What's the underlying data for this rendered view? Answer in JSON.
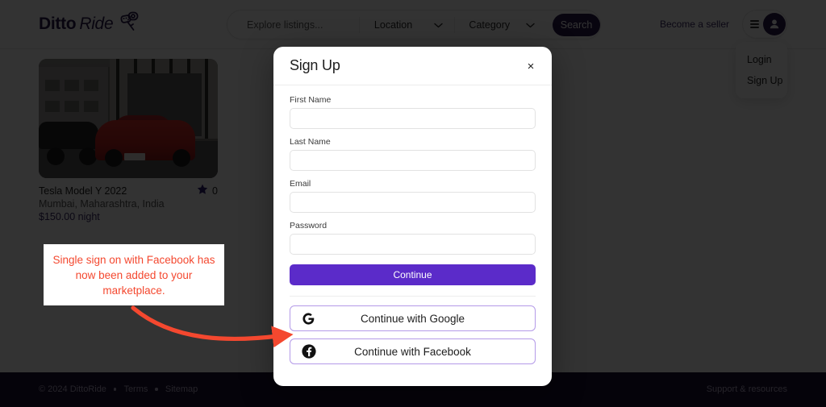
{
  "header": {
    "logo": {
      "part1": "Ditto",
      "part2": "Ride",
      "icon": "car-key-icon"
    },
    "search": {
      "placeholder": "Explore listings...",
      "value": "",
      "location_label": "Location",
      "category_label": "Category",
      "search_button": "Search"
    },
    "become_seller": "Become a seller",
    "account_menu": [
      "Login",
      "Sign Up"
    ]
  },
  "listing": {
    "title": "Tesla Model Y 2022",
    "location": "Mumbai, Maharashtra, India",
    "price": "$150.00 night",
    "rating": "0"
  },
  "modal": {
    "title": "Sign Up",
    "close": "×",
    "fields": [
      {
        "label": "First Name",
        "value": "",
        "placeholder": ""
      },
      {
        "label": "Last Name",
        "value": "",
        "placeholder": ""
      },
      {
        "label": "Email",
        "value": "",
        "placeholder": ""
      },
      {
        "label": "Password",
        "value": "",
        "placeholder": ""
      }
    ],
    "continue_label": "Continue",
    "google_label": "Continue with Google",
    "facebook_label": "Continue with Facebook"
  },
  "annotation": {
    "text": "Single sign on with Facebook has now been added to your marketplace.",
    "color": "#f4482f"
  },
  "footer": {
    "copyright": "© 2024 DittoRide",
    "terms": "Terms",
    "sitemap": "Sitemap",
    "support": "Support & resources"
  },
  "colors": {
    "brand_dark": "#2b1b4d",
    "accent_purple": "#5b2bc9",
    "footer_bg": "#1b0f33",
    "annotation_red": "#f4482f"
  }
}
